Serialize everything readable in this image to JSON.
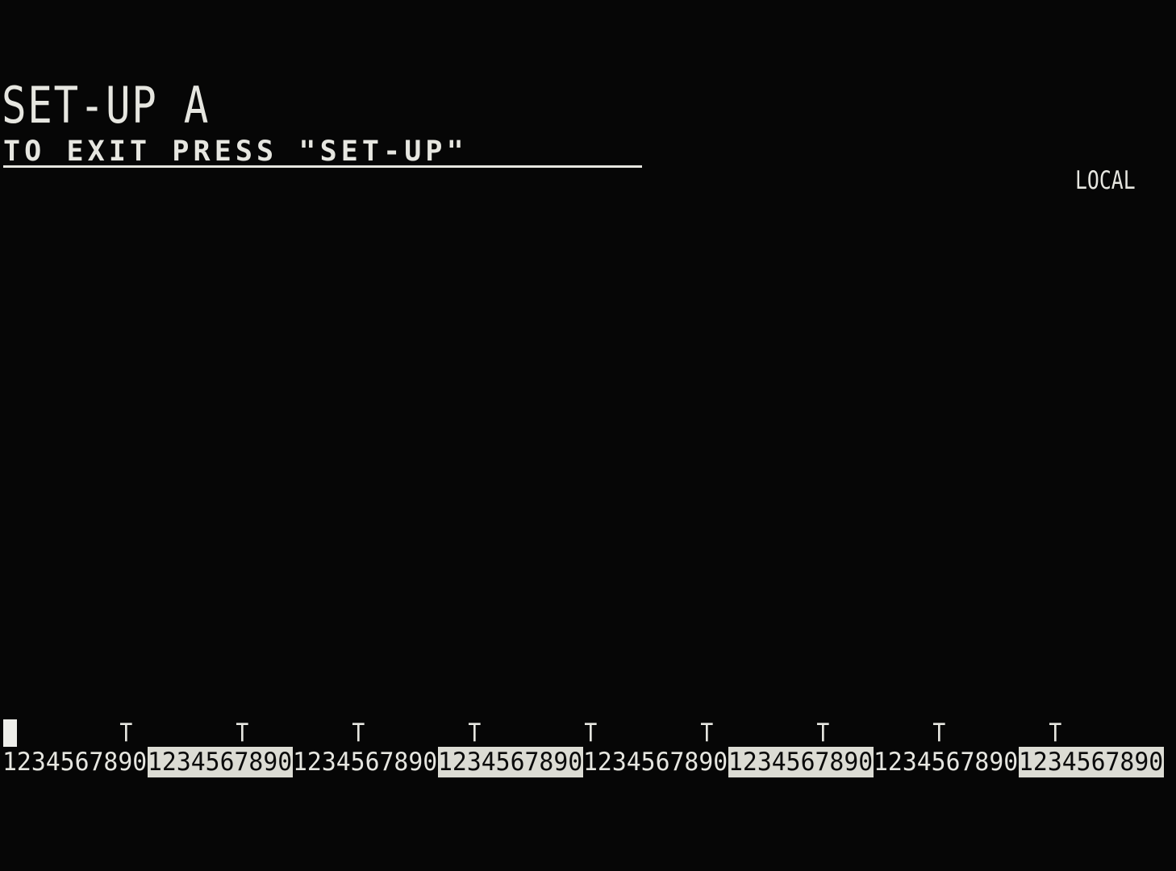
{
  "header": {
    "title": "SET-UP A",
    "exit_hint": "TO EXIT PRESS \"SET-UP\""
  },
  "status": {
    "mode": "LOCAL"
  },
  "tab_stops": {
    "marker": "T",
    "columns": [
      9,
      17,
      25,
      33,
      41,
      49,
      57,
      65,
      73
    ]
  },
  "ruler": {
    "groups": [
      {
        "digits": "1234567890",
        "inverse": false
      },
      {
        "digits": "1234567890",
        "inverse": true
      },
      {
        "digits": "1234567890",
        "inverse": false
      },
      {
        "digits": "1234567890",
        "inverse": true
      },
      {
        "digits": "1234567890",
        "inverse": false
      },
      {
        "digits": "1234567890",
        "inverse": true
      },
      {
        "digits": "1234567890",
        "inverse": false
      },
      {
        "digits": "1234567890",
        "inverse": true
      }
    ]
  },
  "colors": {
    "background": "#060606",
    "foreground": "#e6e6e0",
    "inverse_background": "#dcdcd4"
  }
}
